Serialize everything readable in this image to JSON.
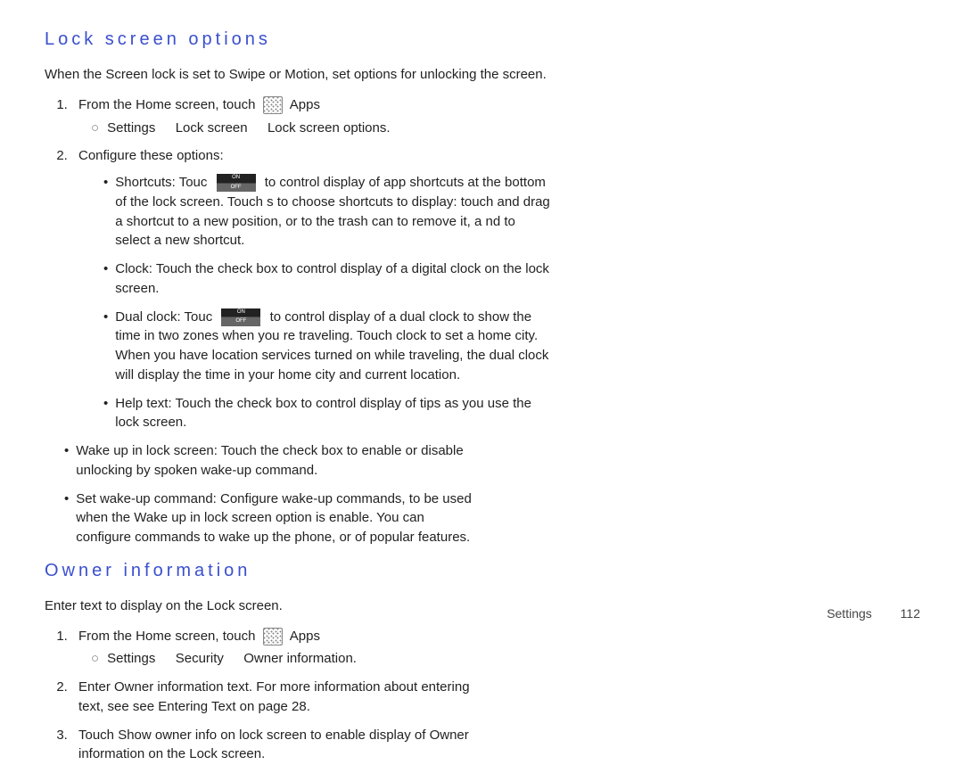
{
  "left": {
    "heading": "Lock screen options",
    "intro": "When the Screen lock is set to Swipe or Motion, set options for unlocking the screen.",
    "steps": [
      {
        "text_before_icon": "From the Home screen, touch ",
        "apps_label": "Apps",
        "sub_parts": [
          "Settings",
          "Lock screen",
          "Lock screen options."
        ]
      },
      {
        "text": "Configure these options:"
      }
    ],
    "options": [
      {
        "term": "Shortcuts",
        "lead": ": Touc",
        "after_toggle": " to control display of app shortcuts at the bottom of the lock screen. Touch s to choose shortcuts to display: touch and drag a shortcut to a new position, or to the trash can to remove it, a nd to select a new shortcut."
      },
      {
        "term": "Clock",
        "body": ": Touch the check box to control display of a digital clock on the lock screen."
      },
      {
        "term": "Dual clock",
        "lead": ": Touc",
        "after_toggle": " to control display of a dual clock to show the time in two zones when you re traveling. Touch clock to set a home city. When you have location services turned on while traveling, the dual clock will display the time in your home city and current location."
      },
      {
        "term": "Help text",
        "body": ": Touch the check box to control display of tips as you use the lock screen."
      }
    ]
  },
  "right": {
    "top_bullets": [
      {
        "term": "Wake up in lock screen",
        "body": ": Touch the check box to enable or disable unlocking by spoken wake-up command."
      },
      {
        "term": "Set wake-up command",
        "body": ": Configure wake-up commands, to be used when the Wake up in lock screen option is enable. You can configure commands to wake up the phone, or of popular features."
      }
    ],
    "heading": "Owner information",
    "intro": "Enter text to display on the Lock screen.",
    "steps": [
      {
        "text_before_icon": "From the Home screen, touch ",
        "apps_label": "Apps",
        "sub_parts": [
          "Settings",
          "Security",
          "Owner information."
        ]
      },
      {
        "html": "Enter Owner information text. For more information about entering text, see see  Entering Text on page 28."
      },
      {
        "html": "Touch Show owner info on lock screen to enable display of Owner information on the Lock screen."
      }
    ]
  },
  "footer": {
    "section": "Settings",
    "page": "112"
  },
  "toggle": {
    "on": "ON",
    "off": "OFF"
  }
}
